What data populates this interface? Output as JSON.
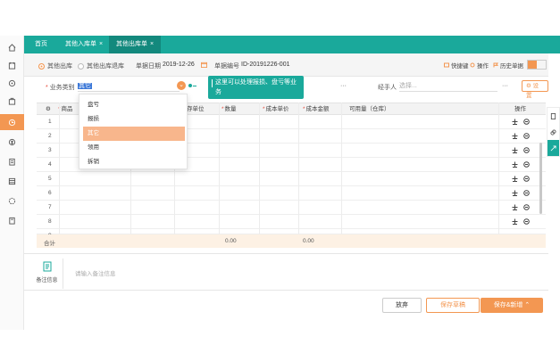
{
  "tabs": [
    {
      "label": "首页",
      "closable": false
    },
    {
      "label": "其他入库单",
      "closable": true
    },
    {
      "label": "其他出库单",
      "closable": true
    }
  ],
  "tab_close_glyph": "×",
  "header": {
    "radio_out": "其他出库",
    "radio_return": "其他出库退库",
    "date_label": "单据日期",
    "date_value": "2019-12-26",
    "no_label": "单据编号",
    "no_value": "ID-20191226-001",
    "btn_quick": "快捷键",
    "btn_ops": "操作",
    "btn_history": "历史单据"
  },
  "filter": {
    "biz_type_label": "业务类别",
    "biz_type_value": "其它",
    "more_dots": "···",
    "handler_label": "经手人",
    "handler_placeholder": "选择...",
    "settings_label": "设置"
  },
  "tooltip_text": "这里可以处理报损、盘亏等业务",
  "dropdown": [
    "盘亏",
    "报损",
    "其它",
    "领用",
    "拆销"
  ],
  "dropdown_selected_index": 2,
  "columns": [
    "商品",
    "",
    "库存单位",
    "数量",
    "成本单价",
    "成本金额",
    "可用量（仓库）",
    "操作"
  ],
  "rows": [
    "1",
    "2",
    "3",
    "4",
    "5",
    "6",
    "7",
    "8",
    "9"
  ],
  "summary": {
    "label": "合计",
    "qty": "0.00",
    "amount": "0.00"
  },
  "remark": {
    "label": "备注信息",
    "placeholder": "请输入备注信息"
  },
  "footer": {
    "discard": "放弃",
    "save_draft": "保存草稿",
    "save_new": "保存&新增 ⌃"
  },
  "colors": {
    "teal": "#1aa99b",
    "orange": "#f39752",
    "highlight": "#f8b68c"
  }
}
